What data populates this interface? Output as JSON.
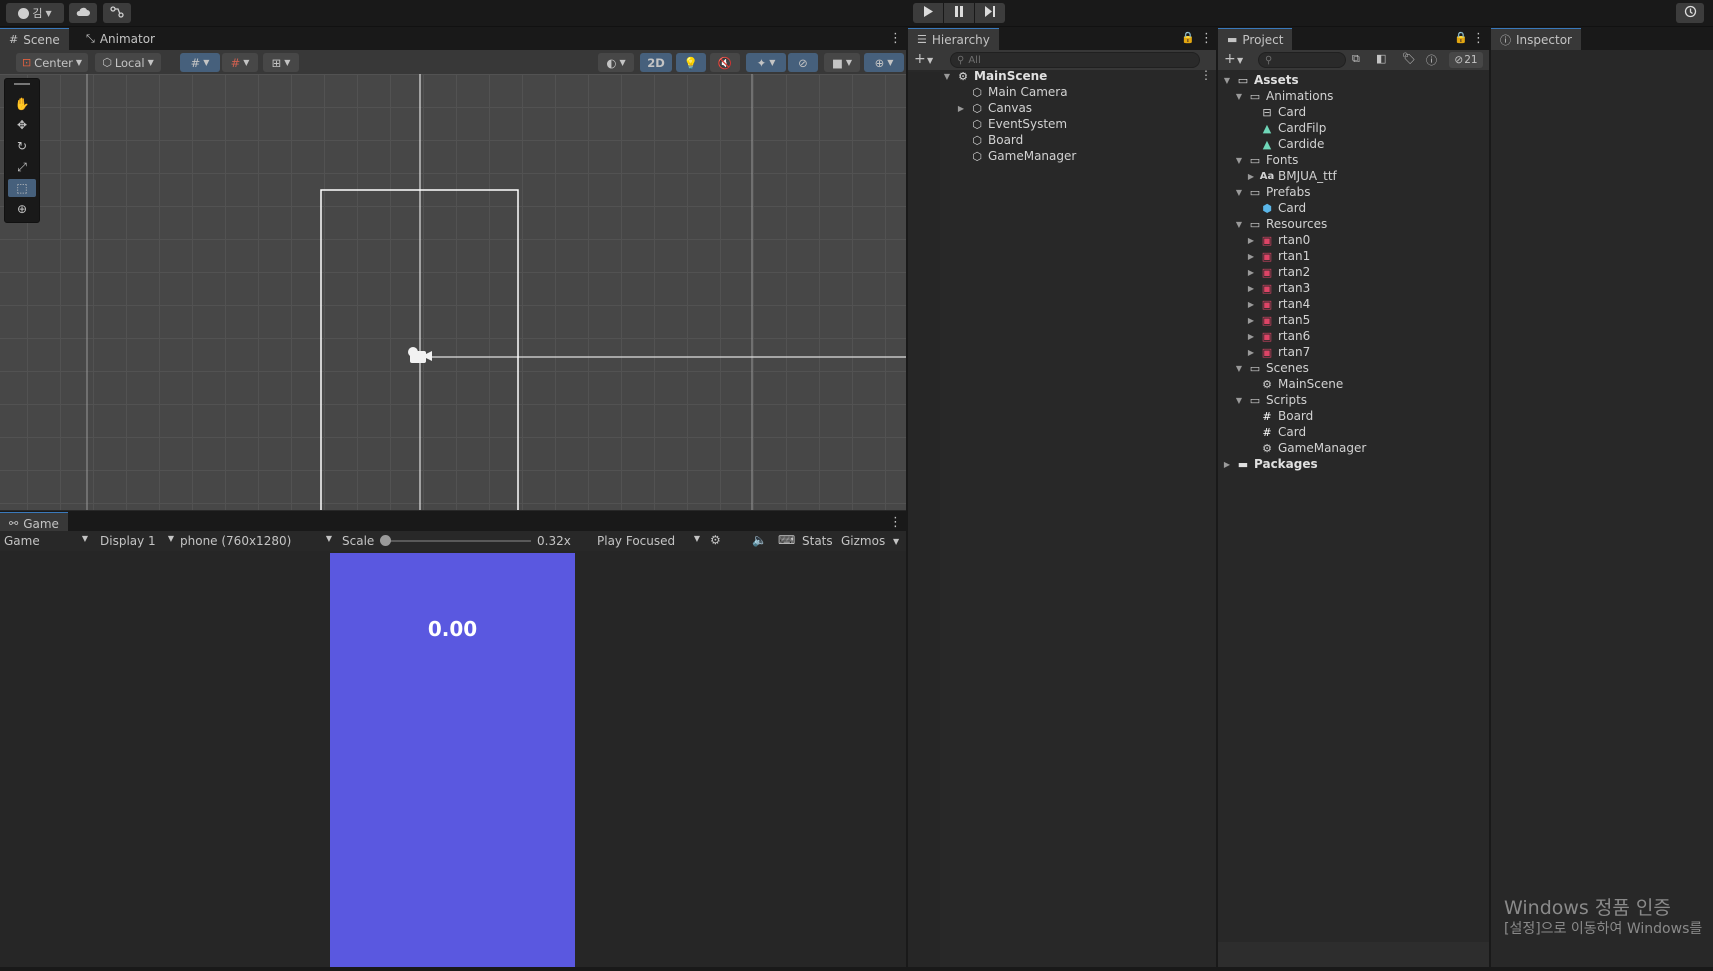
{
  "topbar": {
    "account_label": "김",
    "account_icon": "account-icon",
    "cloud_icon": "cloud-icon",
    "collab_icon": "collab-icon",
    "play_icon": "play-icon",
    "pause_icon": "pause-icon",
    "step_icon": "step-icon",
    "history_icon": "history-icon"
  },
  "scene_panel": {
    "tabs": [
      {
        "label": "Scene",
        "icon": "grid-icon"
      },
      {
        "label": "Animator",
        "icon": "animator-icon"
      }
    ],
    "toolbar": {
      "pivot_label": "Center",
      "space_label": "Local",
      "mode_2d_label": "2D"
    }
  },
  "game_panel": {
    "tab_label": "Game",
    "toolbar": {
      "view_label": "Game",
      "display_label": "Display 1",
      "resolution_label": "phone (760x1280)",
      "scale_label": "Scale",
      "scale_value": "0.32x",
      "scale_fraction": 0.0,
      "play_mode_label": "Play Focused",
      "stats_label": "Stats",
      "gizmos_label": "Gizmos"
    },
    "screen_color": "#5a58e0",
    "timer_text": "0.00"
  },
  "hierarchy": {
    "tab_label": "Hierarchy",
    "search_placeholder": "All",
    "scene_name": "MainScene",
    "items": [
      "Main Camera",
      "Canvas",
      "EventSystem",
      "Board",
      "GameManager"
    ]
  },
  "project": {
    "tab_label": "Project",
    "hidden_count": "21",
    "tree": [
      {
        "label": "Assets",
        "bold": true
      },
      {
        "label": "Animations"
      },
      {
        "label": "Card"
      },
      {
        "label": "CardFilp"
      },
      {
        "label": "Cardide"
      },
      {
        "label": "Fonts"
      },
      {
        "label": "BMJUA_ttf",
        "prefix": "Aa"
      },
      {
        "label": "Prefabs"
      },
      {
        "label": "Card"
      },
      {
        "label": "Resources"
      },
      {
        "label": "rtan0"
      },
      {
        "label": "rtan1"
      },
      {
        "label": "rtan2"
      },
      {
        "label": "rtan3"
      },
      {
        "label": "rtan4"
      },
      {
        "label": "rtan5"
      },
      {
        "label": "rtan6"
      },
      {
        "label": "rtan7"
      },
      {
        "label": "Scenes"
      },
      {
        "label": "MainScene"
      },
      {
        "label": "Scripts"
      },
      {
        "label": "Board"
      },
      {
        "label": "Card"
      },
      {
        "label": "GameManager"
      },
      {
        "label": "Packages",
        "bold": true
      }
    ]
  },
  "inspector": {
    "tab_label": "Inspector"
  },
  "watermark": {
    "line1": "Windows 정품 인증",
    "line2": "[설정]으로 이동하여 Windows를"
  },
  "colors": {
    "accent": "#46607c",
    "game_background": "#5a58e0"
  }
}
